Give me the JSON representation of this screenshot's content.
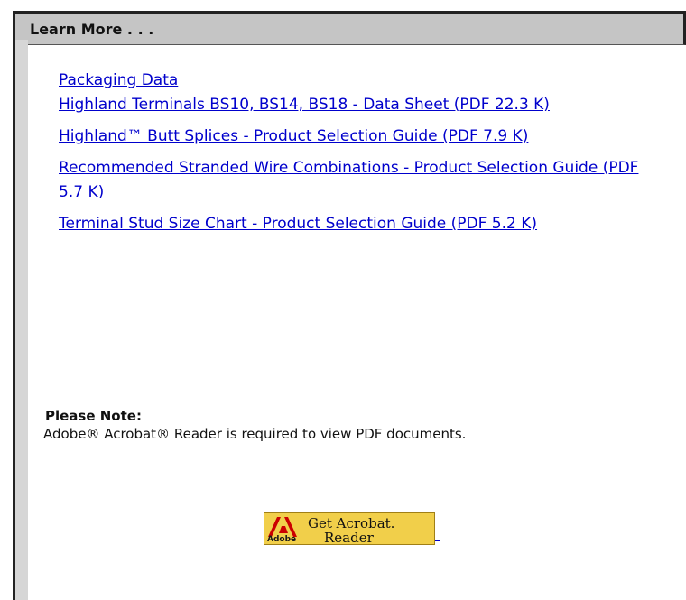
{
  "panel": {
    "title": "Learn More . . ."
  },
  "links": [
    {
      "label": "Packaging Data"
    },
    {
      "label": "Highland Terminals BS10, BS14, BS18 - Data Sheet (PDF 22.3 K)"
    },
    {
      "label": "Highland™ Butt Splices - Product Selection Guide (PDF 7.9 K)"
    },
    {
      "label": "Recommended Stranded Wire Combinations - Product Selection Guide (PDF 5.7 K)"
    },
    {
      "label": "Terminal Stud Size Chart - Product Selection Guide (PDF 5.2 K)"
    }
  ],
  "note": {
    "title": "Please Note:",
    "text": "Adobe® Acrobat® Reader is required to view PDF documents."
  },
  "badge": {
    "brand": "Adobe",
    "line1": "Get Acrobat.",
    "line2": "Reader",
    "logo_icon": "adobe-logo-icon",
    "colors": {
      "background": "#f1cf4a",
      "logo": "#cc0000"
    }
  },
  "colors": {
    "link": "#0000cc",
    "header_bg": "#c5c5c5",
    "left_rule": "#d6d6d6"
  }
}
